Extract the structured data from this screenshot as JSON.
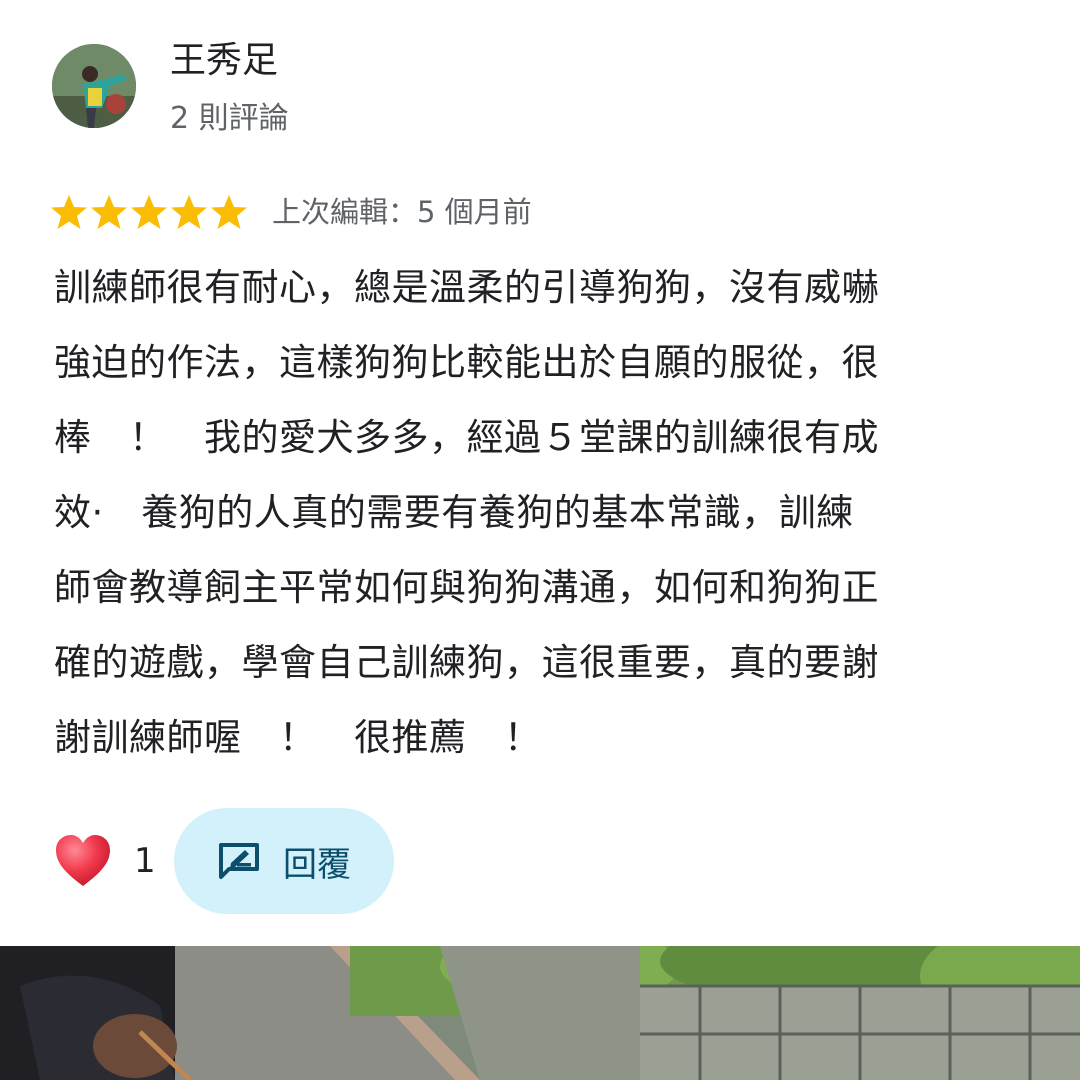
{
  "reviewer": {
    "name": "王秀足",
    "review_count": "2 則評論",
    "avatar_icon": "profile-photo"
  },
  "rating": {
    "stars": 5,
    "max": 5,
    "star_color": "#fbbc04",
    "edited": "上次編輯：5 個月前"
  },
  "review": {
    "lines": [
      "訓練師很有耐心，總是溫柔的引導狗狗，沒有威嚇",
      "強迫的作法，這樣狗狗比較能出於自願的服從，很",
      "棒　！　我的愛犬多多，經過５堂課的訓練很有成",
      "效·　養狗的人真的需要有養狗的基本常識，訓練",
      "師會教導飼主平常如何與狗狗溝通，如何和狗狗正",
      "確的遊戲，學會自己訓練狗，這很重要，真的要謝",
      "謝訓練師喔　！　很推薦　！"
    ]
  },
  "actions": {
    "like_icon": "heart-icon",
    "like_count": "1",
    "reply_icon": "reply-icon",
    "reply_label": "回覆",
    "reply_bg": "#d3f1fb",
    "heart_color": "#ea4335"
  },
  "photo": {
    "description_icon": "review-photo"
  }
}
